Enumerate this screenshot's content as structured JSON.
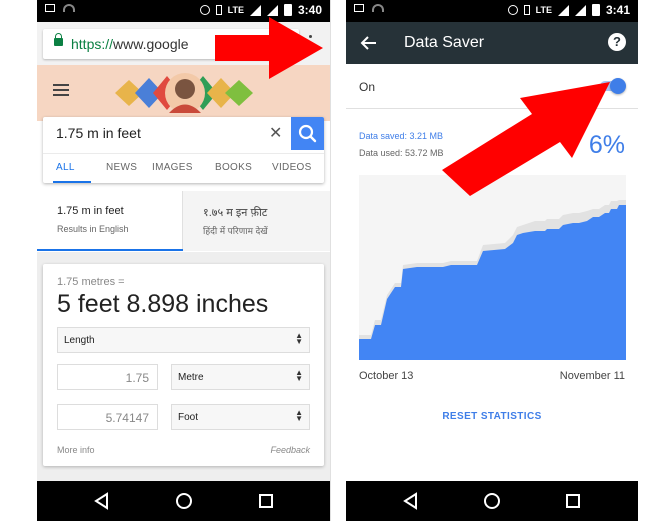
{
  "left_phone": {
    "status": {
      "time": "3:40",
      "network": "LTE"
    },
    "browser": {
      "url_scheme": "https://",
      "url_host": "www.google"
    },
    "search": {
      "query": "1.75 m in feet",
      "clear_icon": "close-icon",
      "search_icon": "search-icon"
    },
    "tabs": [
      "ALL",
      "NEWS",
      "IMAGES",
      "BOOKS",
      "VIDEOS"
    ],
    "lang": {
      "english_title": "1.75 m in feet",
      "english_sub": "Results in English",
      "hindi_title": "१.७५ म इन फ़ीट",
      "hindi_sub": "हिंदी में परिणाम देखें"
    },
    "converter": {
      "from_text": "1.75 metres =",
      "result_text": "5 feet 8.898 inches",
      "category": "Length",
      "input_value": "1.75",
      "input_unit": "Metre",
      "output_value": "5.74147",
      "output_unit": "Foot",
      "more_info": "More info",
      "feedback": "Feedback"
    }
  },
  "right_phone": {
    "status": {
      "time": "3:41",
      "network": "LTE"
    },
    "appbar": {
      "title": "Data Saver"
    },
    "toggle": {
      "label": "On",
      "state": true
    },
    "stats": {
      "saved": "Data saved: 3.21 MB",
      "used": "Data used: 53.72 MB",
      "percent": "6%"
    },
    "dates": {
      "start": "October 13",
      "end": "November 11"
    },
    "reset_label": "RESET STATISTICS"
  },
  "colors": {
    "accent_blue": "#3f7ee8",
    "arrow_red": "#ff0000",
    "appbar_dark": "#263238"
  }
}
